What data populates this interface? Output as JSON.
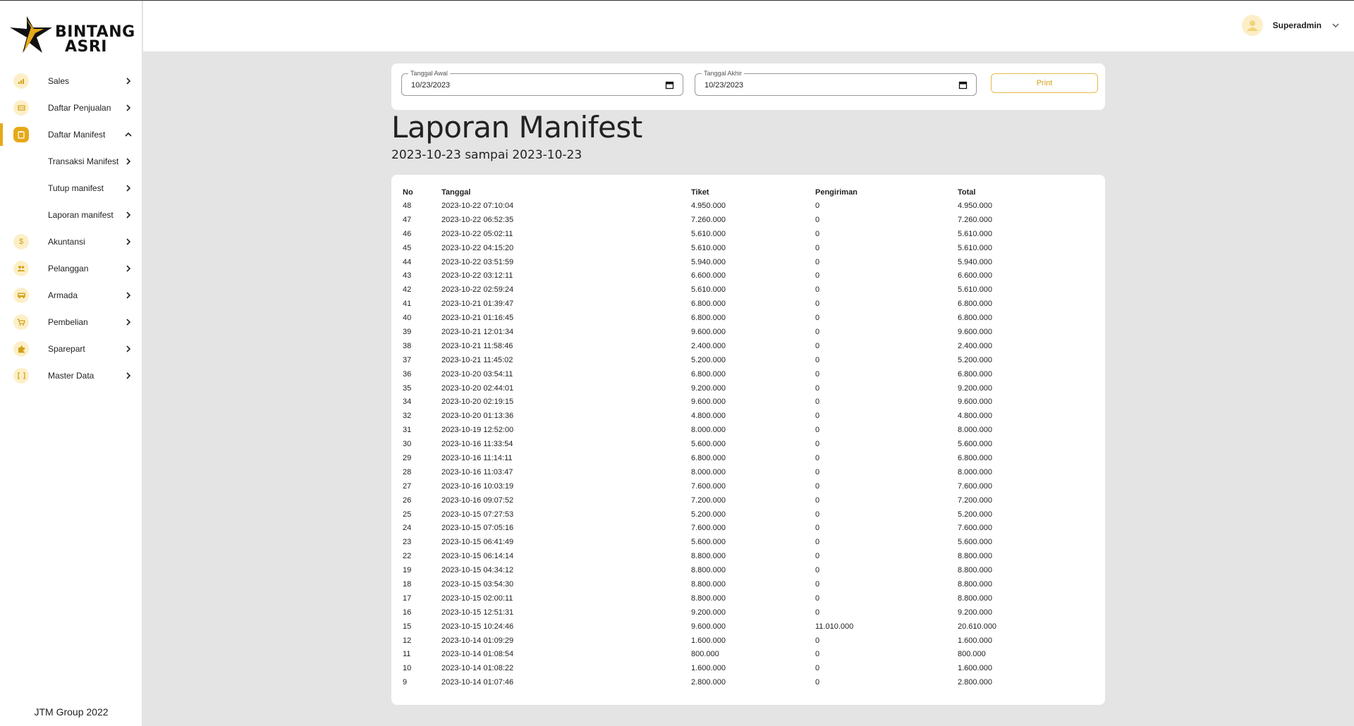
{
  "brand": {
    "line1": "BINTANG",
    "line2": "ASRI",
    "accent": "#e6a817"
  },
  "sidebar": {
    "items": [
      {
        "label": "Sales",
        "icon": "bar-chart-icon"
      },
      {
        "label": "Daftar Penjualan",
        "icon": "list-icon"
      },
      {
        "label": "Daftar Manifest",
        "icon": "clipboard-icon",
        "active": true,
        "expanded": true
      }
    ],
    "subitems": [
      {
        "label": "Transaksi Manifest"
      },
      {
        "label": "Tutup manifest"
      },
      {
        "label": "Laporan manifest"
      }
    ],
    "items2": [
      {
        "label": "Akuntansi",
        "icon": "dollar-icon"
      },
      {
        "label": "Pelanggan",
        "icon": "people-icon"
      },
      {
        "label": "Armada",
        "icon": "bus-icon"
      },
      {
        "label": "Pembelian",
        "icon": "cart-icon"
      },
      {
        "label": "Sparepart",
        "icon": "puzzle-icon"
      },
      {
        "label": "Master Data",
        "icon": "brackets-icon"
      }
    ],
    "footer": "JTM Group 2022"
  },
  "header": {
    "user_name": "Superadmin"
  },
  "filters": {
    "start_label": "Tanggal Awal",
    "start_value": "10/23/2023",
    "end_label": "Tanggal Akhir",
    "end_value": "10/23/2023",
    "print_label": "Print"
  },
  "page": {
    "title": "Laporan Manifest",
    "subtitle": "2023-10-23 sampai 2023-10-23"
  },
  "table": {
    "headers": [
      "No",
      "Tanggal",
      "Tiket",
      "Pengiriman",
      "Total"
    ],
    "rows": [
      [
        "48",
        "2023-10-22 07:10:04",
        "4.950.000",
        "0",
        "4.950.000"
      ],
      [
        "47",
        "2023-10-22 06:52:35",
        "7.260.000",
        "0",
        "7.260.000"
      ],
      [
        "46",
        "2023-10-22 05:02:11",
        "5.610.000",
        "0",
        "5.610.000"
      ],
      [
        "45",
        "2023-10-22 04:15:20",
        "5.610.000",
        "0",
        "5.610.000"
      ],
      [
        "44",
        "2023-10-22 03:51:59",
        "5.940.000",
        "0",
        "5.940.000"
      ],
      [
        "43",
        "2023-10-22 03:12:11",
        "6.600.000",
        "0",
        "6.600.000"
      ],
      [
        "42",
        "2023-10-22 02:59:24",
        "5.610.000",
        "0",
        "5.610.000"
      ],
      [
        "41",
        "2023-10-21 01:39:47",
        "6.800.000",
        "0",
        "6.800.000"
      ],
      [
        "40",
        "2023-10-21 01:16:45",
        "6.800.000",
        "0",
        "6.800.000"
      ],
      [
        "39",
        "2023-10-21 12:01:34",
        "9.600.000",
        "0",
        "9.600.000"
      ],
      [
        "38",
        "2023-10-21 11:58:46",
        "2.400.000",
        "0",
        "2.400.000"
      ],
      [
        "37",
        "2023-10-21 11:45:02",
        "5.200.000",
        "0",
        "5.200.000"
      ],
      [
        "36",
        "2023-10-20 03:54:11",
        "6.800.000",
        "0",
        "6.800.000"
      ],
      [
        "35",
        "2023-10-20 02:44:01",
        "9.200.000",
        "0",
        "9.200.000"
      ],
      [
        "34",
        "2023-10-20 02:19:15",
        "9.600.000",
        "0",
        "9.600.000"
      ],
      [
        "32",
        "2023-10-20 01:13:36",
        "4.800.000",
        "0",
        "4.800.000"
      ],
      [
        "31",
        "2023-10-19 12:52:00",
        "8.000.000",
        "0",
        "8.000.000"
      ],
      [
        "30",
        "2023-10-16 11:33:54",
        "5.600.000",
        "0",
        "5.600.000"
      ],
      [
        "29",
        "2023-10-16 11:14:11",
        "6.800.000",
        "0",
        "6.800.000"
      ],
      [
        "28",
        "2023-10-16 11:03:47",
        "8.000.000",
        "0",
        "8.000.000"
      ],
      [
        "27",
        "2023-10-16 10:03:19",
        "7.600.000",
        "0",
        "7.600.000"
      ],
      [
        "26",
        "2023-10-16 09:07:52",
        "7.200.000",
        "0",
        "7.200.000"
      ],
      [
        "25",
        "2023-10-15 07:27:53",
        "5.200.000",
        "0",
        "5.200.000"
      ],
      [
        "24",
        "2023-10-15 07:05:16",
        "7.600.000",
        "0",
        "7.600.000"
      ],
      [
        "23",
        "2023-10-15 06:41:49",
        "5.600.000",
        "0",
        "5.600.000"
      ],
      [
        "22",
        "2023-10-15 06:14:14",
        "8.800.000",
        "0",
        "8.800.000"
      ],
      [
        "19",
        "2023-10-15 04:34:12",
        "8.800.000",
        "0",
        "8.800.000"
      ],
      [
        "18",
        "2023-10-15 03:54:30",
        "8.800.000",
        "0",
        "8.800.000"
      ],
      [
        "17",
        "2023-10-15 02:00:11",
        "8.800.000",
        "0",
        "8.800.000"
      ],
      [
        "16",
        "2023-10-15 12:51:31",
        "9.200.000",
        "0",
        "9.200.000"
      ],
      [
        "15",
        "2023-10-15 10:24:46",
        "9.600.000",
        "11.010.000",
        "20.610.000"
      ],
      [
        "12",
        "2023-10-14 01:09:29",
        "1.600.000",
        "0",
        "1.600.000"
      ],
      [
        "11",
        "2023-10-14 01:08:54",
        "800.000",
        "0",
        "800.000"
      ],
      [
        "10",
        "2023-10-14 01:08:22",
        "1.600.000",
        "0",
        "1.600.000"
      ],
      [
        "9",
        "2023-10-14 01:07:46",
        "2.800.000",
        "0",
        "2.800.000"
      ]
    ]
  }
}
